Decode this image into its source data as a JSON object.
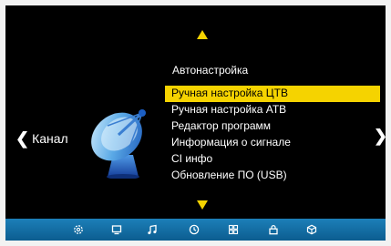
{
  "navigation": {
    "left_label": "Канал"
  },
  "menu": {
    "title": "Автонастройка",
    "items": [
      {
        "label": "Ручная настройка ЦТВ",
        "selected": true
      },
      {
        "label": "Ручная настройка АТВ",
        "selected": false
      },
      {
        "label": "Редактор программ",
        "selected": false
      },
      {
        "label": "Информация о сигнале",
        "selected": false
      },
      {
        "label": "CI инфо",
        "selected": false
      },
      {
        "label": "Обновление ПО (USB)",
        "selected": false
      }
    ]
  },
  "bottom_bar": {
    "icons": [
      "settings-icon",
      "picture-icon",
      "sound-icon",
      "clock-icon",
      "channel-grid-icon",
      "lock-icon",
      "package-icon"
    ]
  },
  "colors": {
    "highlight": "#f5d300",
    "bar": "#1c7fb8",
    "background": "#000000"
  }
}
